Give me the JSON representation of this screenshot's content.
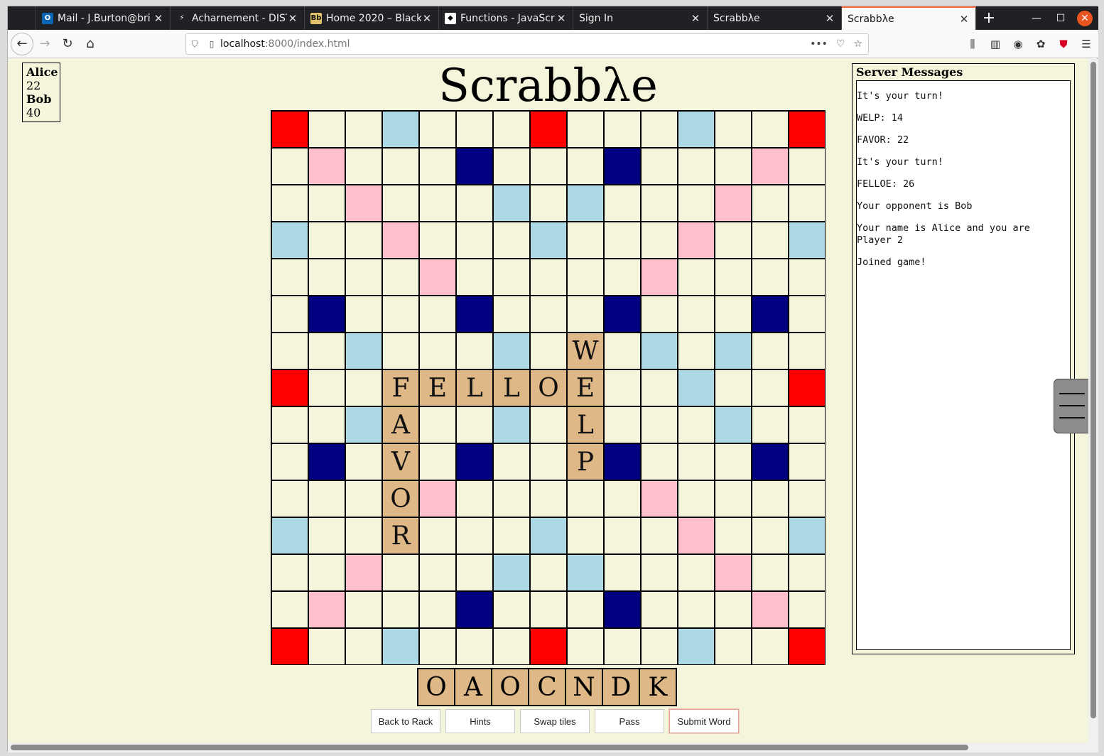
{
  "browser": {
    "tabs": [
      {
        "label": "",
        "icon": "firefox-view-icon"
      },
      {
        "label": "Mail - J.Burton@bri",
        "icon": "outlook-icon"
      },
      {
        "label": "Acharnement - DIST",
        "icon": "bolt-icon"
      },
      {
        "label": "Home 2020 – Black",
        "icon": "blackboard-icon"
      },
      {
        "label": "Functions - JavaScri",
        "icon": "mdn-icon"
      },
      {
        "label": "Sign In",
        "icon": ""
      },
      {
        "label": "Scrabbλe",
        "icon": ""
      },
      {
        "label": "Scrabbλe",
        "icon": "",
        "active": true
      }
    ],
    "url_host": "localhost",
    "url_path": ":8000/index.html"
  },
  "scores": {
    "players": [
      {
        "name": "Alice",
        "score": "22"
      },
      {
        "name": "Bob",
        "score": "40"
      }
    ]
  },
  "title": "Scrabbλe",
  "board": {
    "premium_rows": [
      "T..d...T...d..T",
      ".D...t...t...D.",
      "..D...d.d...D..",
      "d..D...d...D..d",
      "....D.....D....",
      ".t...t...t...t.",
      "..d...d...d.d..",
      "T..............",
      "..d...d.....d..",
      ".t...t...t...t.",
      "....D.....D....",
      "d..D...d...D..d",
      "..D...d.d...D..",
      ".D...t...t...D.",
      "T..d...T...d..T"
    ],
    "extra_premiums": [
      {
        "row": 7,
        "col": 11,
        "type": "d"
      },
      {
        "row": 7,
        "col": 14,
        "type": "T"
      }
    ],
    "tiles": [
      {
        "row": 6,
        "col": 8,
        "letter": "W"
      },
      {
        "row": 7,
        "col": 3,
        "letter": "F"
      },
      {
        "row": 7,
        "col": 4,
        "letter": "E"
      },
      {
        "row": 7,
        "col": 5,
        "letter": "L"
      },
      {
        "row": 7,
        "col": 6,
        "letter": "L"
      },
      {
        "row": 7,
        "col": 7,
        "letter": "O"
      },
      {
        "row": 7,
        "col": 8,
        "letter": "E"
      },
      {
        "row": 8,
        "col": 3,
        "letter": "A"
      },
      {
        "row": 8,
        "col": 8,
        "letter": "L"
      },
      {
        "row": 9,
        "col": 3,
        "letter": "V"
      },
      {
        "row": 9,
        "col": 8,
        "letter": "P"
      },
      {
        "row": 10,
        "col": 3,
        "letter": "O"
      },
      {
        "row": 11,
        "col": 3,
        "letter": "R"
      }
    ],
    "colors": {
      "triple_word": "#ff0000",
      "double_word": "#ffc0cb",
      "triple_letter": "#000080",
      "double_letter": "#add8e6",
      "tile": "#deb887",
      "empty": "#f5f5dc"
    }
  },
  "rack": [
    "O",
    "A",
    "O",
    "C",
    "N",
    "D",
    "K"
  ],
  "actions": {
    "back_to_rack": "Back to Rack",
    "hints": "Hints",
    "swap_tiles": "Swap tiles",
    "pass": "Pass",
    "submit_word": "Submit Word"
  },
  "messages": {
    "heading": "Server Messages",
    "lines": [
      "It's your turn!",
      "WELP: 14",
      "FAVOR: 22",
      "It's your turn!",
      "FELLOE: 26",
      "Your opponent is Bob",
      "Your name is Alice and you are Player 2",
      "Joined game!"
    ]
  }
}
